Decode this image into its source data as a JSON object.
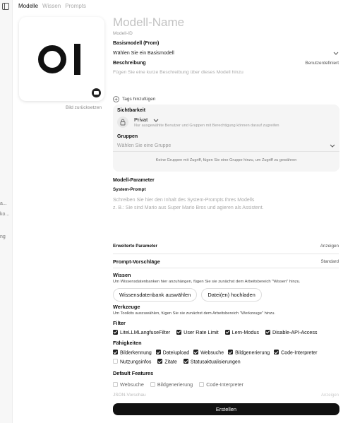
{
  "tabs": [
    {
      "label": "Modelle",
      "active": true
    },
    {
      "label": "Wissen",
      "active": false
    },
    {
      "label": "Prompts",
      "active": false
    }
  ],
  "image_reset": "Bild zurücksetzen",
  "model_name_placeholder": "Modell-Name",
  "model_id_placeholder": "Modell-ID",
  "base_model": {
    "label": "Basismodell (From)",
    "placeholder": "Wählen Sie ein Basismodell"
  },
  "description": {
    "label": "Beschreibung",
    "mode": "Benutzerdefiniert",
    "placeholder": "Fügen Sie eine kurze Beschreibung über dieses Modell hinzu"
  },
  "tags": {
    "add_label": "Tags hinzufügen"
  },
  "visibility": {
    "label": "Sichtbarkeit",
    "value": "Privat",
    "hint": "Nur ausgewählte Benutzer und Gruppen mit Berechtigung können darauf zugreifen",
    "groups_label": "Gruppen",
    "groups_placeholder": "Wählen Sie eine Gruppe",
    "groups_empty": "Keine Gruppen mit Zugriff, fügen Sie eine Gruppe hinzu, um Zugriff zu gewähren"
  },
  "model_params": {
    "label": "Modell-Parameter",
    "system_prompt_label": "System-Prompt",
    "system_prompt_placeholder_1": "Schreiben Sie hier den Inhalt des System-Prompts Ihres Modells",
    "system_prompt_placeholder_2": "z. B.: Sie sind Mario aus Super Mario Bros und agieren als Assistent."
  },
  "advanced": {
    "label": "Erweiterte Parameter",
    "action": "Anzeigen"
  },
  "prompt_suggestions": {
    "label": "Prompt-Vorschläge",
    "value": "Standard"
  },
  "knowledge": {
    "label": "Wissen",
    "hint": "Um Wissensdatenbanken hier anzuhängen, fügen Sie sie zunächst dem Arbeitsbereich \"Wissen\" hinzu.",
    "select_button": "Wissensdatenbank auswählen",
    "upload_button": "Datei(en) hochladen"
  },
  "tools": {
    "label": "Werkzeuge",
    "hint": "Um Toolkits auszuwählen, fügen Sie sie zunächst dem Arbeitsbereich \"Werkzeuge\" hinzu."
  },
  "filter": {
    "label": "Filter",
    "items": [
      {
        "label": "LiteLLMLangfuseFilter",
        "checked": true
      },
      {
        "label": "User Rate Limit",
        "checked": true
      },
      {
        "label": "Lern-Modus",
        "checked": true
      },
      {
        "label": "Disable-API-Access",
        "checked": true
      }
    ]
  },
  "capabilities": {
    "label": "Fähigkeiten",
    "items": [
      {
        "label": "Bilderkennung",
        "checked": true
      },
      {
        "label": "Dateiupload",
        "checked": true
      },
      {
        "label": "Websuche",
        "checked": true
      },
      {
        "label": "Bildgenerierung",
        "checked": true
      },
      {
        "label": "Code-Interpreter",
        "checked": true
      },
      {
        "label": "Nutzungsinfos",
        "checked": false
      },
      {
        "label": "Zitate",
        "checked": true
      },
      {
        "label": "Statusaktualisierungen",
        "checked": true
      }
    ]
  },
  "default_features": {
    "label": "Default Features",
    "items": [
      {
        "label": "Websuche",
        "checked": false
      },
      {
        "label": "Bildgenerierung",
        "checked": false
      },
      {
        "label": "Code-Interpreter",
        "checked": false
      }
    ]
  },
  "json_preview": {
    "label": "JSON-Vorschau",
    "action": "Anzeigen"
  },
  "submit": "Erstellen",
  "sidebar_fragments": [
    "a...",
    "ko...",
    "ng"
  ]
}
